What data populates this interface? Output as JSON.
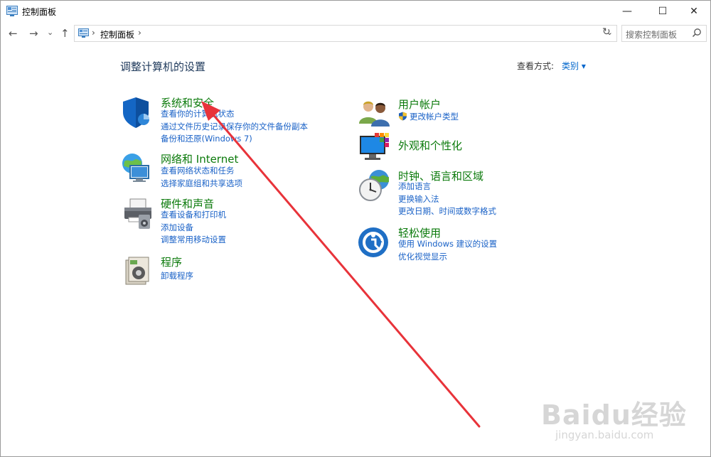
{
  "window": {
    "title": "控制面板",
    "controls": {
      "minimize": "—",
      "maximize": "☐",
      "close": "✕"
    }
  },
  "nav": {
    "back": "←",
    "forward": "→",
    "recent": "⌄",
    "up": "↑",
    "address_segment": "控制面板",
    "address_sep": "›",
    "dropdown": "⌄",
    "refresh": "↻",
    "search_placeholder": "搜索控制面板"
  },
  "main": {
    "title": "调整计算机的设置",
    "view_by_label": "查看方式:",
    "view_by_value": "类别 ▾"
  },
  "categories": [
    {
      "icon": "shield-icon",
      "title": "系统和安全",
      "links": [
        "查看你的计算机状态",
        "通过文件历史记录保存你的文件备份副本",
        "备份和还原(Windows 7)"
      ]
    },
    {
      "icon": "network-globe-icon",
      "title": "网络和 Internet",
      "links": [
        "查看网络状态和任务",
        "选择家庭组和共享选项"
      ]
    },
    {
      "icon": "printer-icon",
      "title": "硬件和声音",
      "links": [
        "查看设备和打印机",
        "添加设备",
        "调整常用移动设置"
      ]
    },
    {
      "icon": "programs-icon",
      "title": "程序",
      "links": [
        "卸载程序"
      ]
    },
    {
      "icon": "users-icon",
      "title": "用户帐户",
      "links": [
        "更改帐户类型"
      ]
    },
    {
      "icon": "monitor-color-icon",
      "title": "外观和个性化",
      "links": []
    },
    {
      "icon": "clock-globe-icon",
      "title": "时钟、语言和区域",
      "links": [
        "添加语言",
        "更换输入法",
        "更改日期、时间或数字格式"
      ]
    },
    {
      "icon": "ease-of-access-icon",
      "title": "轻松使用",
      "links": [
        "使用 Windows 建议的设置",
        "优化视觉显示"
      ]
    }
  ],
  "watermark": {
    "brand": "Baidu经验",
    "url": "jingyan.baidu.com"
  },
  "colors": {
    "category_title": "#0b7a0b",
    "link": "#1a62c7",
    "annotation_arrow": "#e8333a"
  }
}
